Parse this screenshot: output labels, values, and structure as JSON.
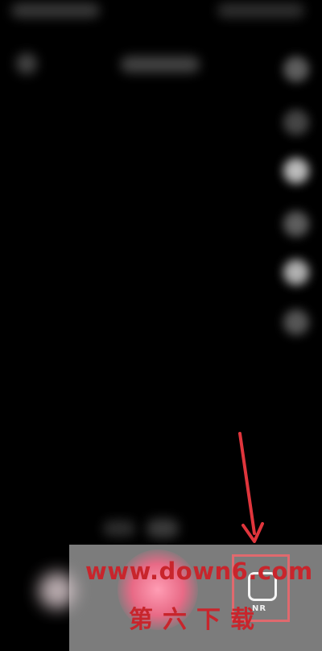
{
  "watermark": {
    "url": "www.down6.com",
    "site_name": "第六下载"
  },
  "shortcut": {
    "label": "NR",
    "icon": "square-outline-icon",
    "highlighted": true
  },
  "annotation": {
    "icon": "arrow-down-icon",
    "color": "#e0353c"
  },
  "colors": {
    "background": "#000000",
    "bottom_bar": "#7c7c7c",
    "shutter": "#e86a86",
    "highlight": "#e0696e",
    "watermark": "#c8252c"
  }
}
